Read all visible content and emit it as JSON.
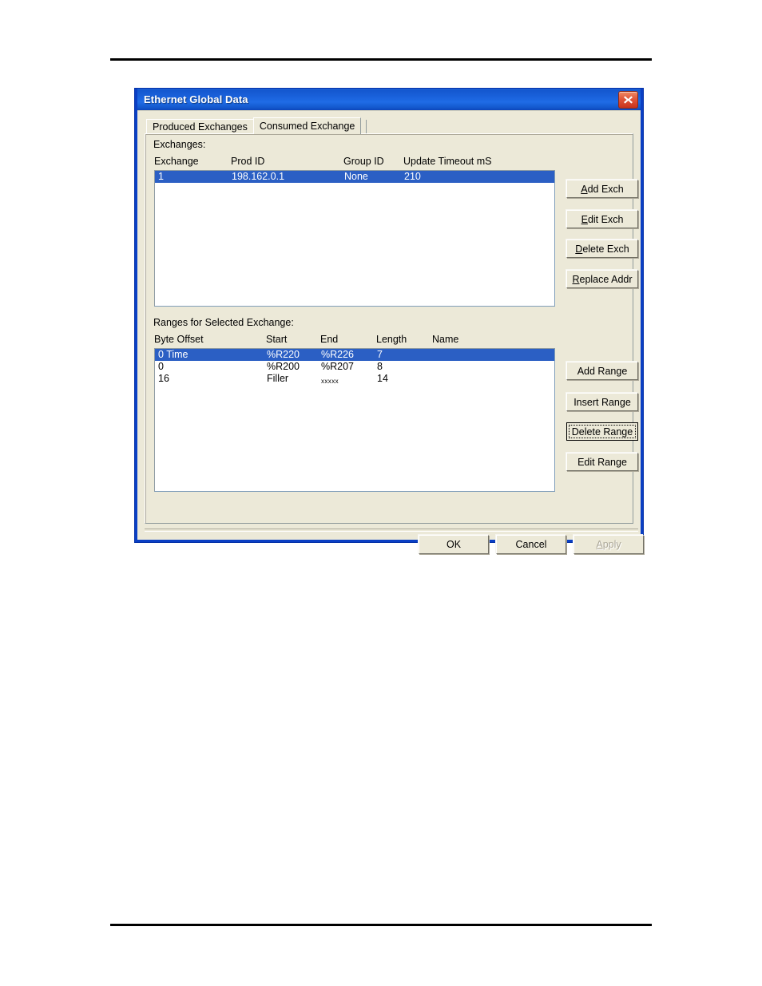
{
  "window": {
    "title": "Ethernet Global Data",
    "close_icon": "close-icon"
  },
  "tabs": [
    {
      "label": "Produced Exchanges",
      "active": false
    },
    {
      "label": "Consumed Exchange",
      "active": true
    }
  ],
  "exchanges_section": {
    "label": "Exchanges:",
    "columns": [
      "Exchange",
      "Prod ID",
      "Group ID",
      "Update Timeout mS"
    ],
    "rows": [
      {
        "exchange": "1",
        "prod_id": "198.162.0.1",
        "group_id": "None",
        "update_timeout_ms": "210",
        "selected": true
      }
    ],
    "buttons": [
      {
        "label": "Add Exch",
        "mnemonic": "A",
        "enabled": true,
        "focused": false
      },
      {
        "label": "Edit Exch",
        "mnemonic": "E",
        "enabled": true,
        "focused": false
      },
      {
        "label": "Delete Exch",
        "mnemonic": "D",
        "enabled": true,
        "focused": false
      },
      {
        "label": "Replace Addr",
        "mnemonic": "R",
        "enabled": true,
        "focused": false
      }
    ]
  },
  "ranges_section": {
    "label": "Ranges for Selected Exchange:",
    "columns": [
      "Byte Offset",
      "Start",
      "End",
      "Length",
      "Name"
    ],
    "rows": [
      {
        "byte_offset": "0  Time",
        "start": "%R220",
        "end": "%R226",
        "length": "7",
        "name": "",
        "selected": true
      },
      {
        "byte_offset": "0",
        "start": "%R200",
        "end": "%R207",
        "length": "8",
        "name": "",
        "selected": false
      },
      {
        "byte_offset": "16",
        "start": "Filler",
        "end": "xxxxx",
        "length": "14",
        "name": "",
        "selected": false
      }
    ],
    "buttons": [
      {
        "label": "Add Range",
        "mnemonic": "",
        "enabled": true,
        "focused": false
      },
      {
        "label": "Insert Range",
        "mnemonic": "",
        "enabled": true,
        "focused": false
      },
      {
        "label": "Delete Range",
        "mnemonic": "",
        "enabled": true,
        "focused": true
      },
      {
        "label": "Edit Range",
        "mnemonic": "",
        "enabled": true,
        "focused": false
      }
    ]
  },
  "footer": {
    "ok_label": "OK",
    "cancel_label": "Cancel",
    "apply_label": "Apply",
    "apply_mnemonic": "A",
    "apply_enabled": false
  },
  "colors": {
    "title_bar": "#1a62dc",
    "selection": "#2b5fc4",
    "dialog_face": "#ece9d8",
    "close_button": "#c9331c",
    "list_background": "#ffffff",
    "disabled_text": "#aca899"
  }
}
